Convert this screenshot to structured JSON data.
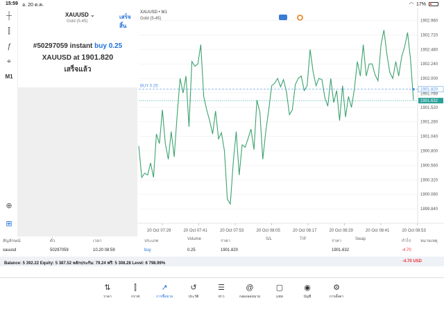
{
  "statusbar": {
    "time": "15:59",
    "date": "อ. 20 ต.ค.",
    "battery": "17%"
  },
  "toolbar": {
    "items": [
      {
        "name": "crosshair-icon",
        "glyph": "┼"
      },
      {
        "name": "candle-icon",
        "glyph": "⫿"
      },
      {
        "name": "function-icon",
        "glyph": "ƒ"
      },
      {
        "name": "objects-icon",
        "glyph": "⌖"
      },
      {
        "name": "timeframe",
        "glyph": "M1"
      }
    ],
    "bottom": [
      {
        "name": "zoom-icon",
        "glyph": "⊕"
      },
      {
        "name": "add-icon",
        "glyph": "⊞"
      }
    ]
  },
  "trade_panel": {
    "symbol": "XAUUSD",
    "symbol_sub": "Gold (5-45)",
    "done_label": "เสร็จสิ้น",
    "line1_prefix": "#50297059 instant ",
    "line1_highlight": "buy 0.25",
    "line2_prefix": "XAUUSD at ",
    "line2_price": "1901.820",
    "line3": "เสร็จแล้ว"
  },
  "chart": {
    "title": "XAUUSD • M1",
    "subtitle": "Gold (5-45)",
    "buy_label": "BUY 0.25",
    "colors": {
      "line": "#3aa26d",
      "grid": "#e4e4e4",
      "buy": "#4a90e2",
      "bid": "#2aa198",
      "axis_text": "#555"
    }
  },
  "chart_data": {
    "type": "line",
    "ylim": [
      1899.6,
      1903.0
    ],
    "y_ticks": [
      "1902.960",
      "1902.720",
      "1902.480",
      "1902.240",
      "1902.000",
      "1901.760",
      "1901.520",
      "1901.280",
      "1901.040",
      "1900.800",
      "1900.560",
      "1900.320",
      "1900.080",
      "1899.840"
    ],
    "x_ticks": [
      "20 Oct 07:29",
      "20 Oct 07:41",
      "20 Oct 07:53",
      "20 Oct 08:05",
      "20 Oct 08:17",
      "20 Oct 08:29",
      "20 Oct 08:41",
      "20 Oct 08:53"
    ],
    "buy_price": 1901.82,
    "buy_price_label": "1901.820",
    "ask_label": "1901.760",
    "bid_price": 1901.632,
    "bid_price_label": "1901.632",
    "values": [
      1900.88,
      1900.36,
      1900.43,
      1900.4,
      1900.6,
      1900.36,
      1901.08,
      1900.92,
      1901.48,
      1900.92,
      1900.66,
      1901.12,
      1900.7,
      1901.4,
      1902.0,
      1901.76,
      1902.04,
      1901.2,
      1902.28,
      1902.2,
      1902.24,
      1902.56,
      1901.7,
      1901.48,
      1901.3,
      1901.08,
      1901.46,
      1901.0,
      1901.1,
      1900.8,
      1900.0,
      1899.92,
      1900.62,
      1901.12,
      1900.4,
      1900.9,
      1900.86,
      1901.0,
      1901.16,
      1900.82,
      1901.64,
      1901.44,
      1900.66,
      1901.12,
      1901.48,
      1901.88,
      1901.92,
      1902.0,
      1901.86,
      1901.98,
      1901.78,
      1901.4,
      1901.48,
      1901.9,
      1902.0,
      1902.04,
      1901.8,
      1901.88,
      1902.48,
      1902.12,
      1901.88,
      1902.0,
      1901.98,
      1901.68,
      1901.54,
      1902.0,
      1901.6,
      1901.8,
      1901.3,
      1901.88,
      1901.36,
      1901.7,
      1901.52,
      1901.82,
      1902.28,
      1902.04,
      1902.56,
      1902.04,
      1902.24,
      1902.24,
      1902.06,
      1901.96,
      1902.56,
      1902.8,
      1902.4,
      1902.1,
      1902.0,
      1902.28,
      1902.04,
      1902.36,
      1902.52,
      1902.76,
      1902.32,
      1901.64
    ]
  },
  "positions": {
    "headers": [
      "สัญลักษณ์",
      "ตั๋ว",
      "เวลา",
      "ประเภท",
      "Volume",
      "ราคา",
      "S/L",
      "T/P",
      "ราคา",
      "Swap",
      "กำไร",
      "หมายเหตุ"
    ],
    "row": [
      "xauusd",
      "50297059",
      "10.20 08:59",
      "buy",
      "0.25",
      "1901.820",
      "",
      "",
      "1901.632",
      "",
      "-4.70",
      ""
    ]
  },
  "balance": {
    "text": "Balance: 5 392.22 Equity: 5 387.52 หลักประกัน: 79.24 ฟรี: 5 308.28 Level: 6 798.99%",
    "profit": "-4.70  USD"
  },
  "nav": [
    {
      "name": "nav-quotes",
      "icon": "⇅",
      "label": "ราคา"
    },
    {
      "name": "nav-chart",
      "icon": "⫿",
      "label": "กราฟ"
    },
    {
      "name": "nav-trade",
      "icon": "↗",
      "label": "การซื้อขาย",
      "active": true
    },
    {
      "name": "nav-history",
      "icon": "↺",
      "label": "ประวัติ"
    },
    {
      "name": "nav-news",
      "icon": "☰",
      "label": "ข่าว"
    },
    {
      "name": "nav-mailbox",
      "icon": "@",
      "label": "กล่องจดหมาย"
    },
    {
      "name": "nav-chat",
      "icon": "▢",
      "label": "แชท"
    },
    {
      "name": "nav-accounts",
      "icon": "◉",
      "label": "บัญชี"
    },
    {
      "name": "nav-settings",
      "icon": "⚙",
      "label": "การตั้งค่า"
    }
  ]
}
